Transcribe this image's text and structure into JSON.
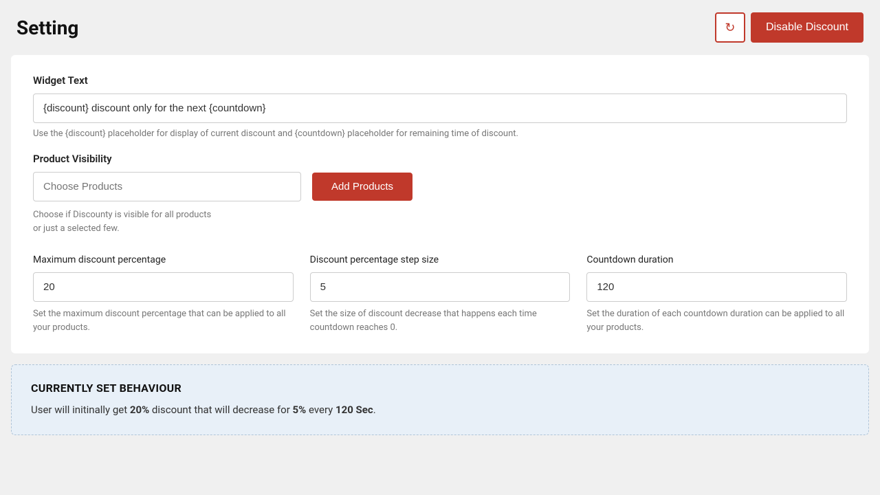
{
  "header": {
    "title": "Setting",
    "refresh_label": "↻",
    "disable_discount_label": "Disable Discount"
  },
  "widget_text_section": {
    "label": "Widget Text",
    "input_value": "{discount} discount only for the next {countdown}",
    "hint": "Use the {discount} placeholder for display of current discount and {countdown} placeholder for remaining time of discount."
  },
  "product_visibility_section": {
    "label": "Product Visibility",
    "choose_products_placeholder": "Choose Products",
    "add_products_label": "Add Products",
    "hint_line1": "Choose if Discounty is visible for all products",
    "hint_line2": "or just a selected few."
  },
  "metrics": {
    "max_discount": {
      "label": "Maximum discount percentage",
      "value": "20",
      "hint": "Set the maximum discount percentage that can be applied to all your products."
    },
    "step_size": {
      "label": "Discount percentage step size",
      "value": "5",
      "hint": "Set the size of discount decrease that happens each time countdown reaches 0."
    },
    "countdown": {
      "label": "Countdown duration",
      "value": "120",
      "hint": "Set the duration of each countdown duration can be applied to all your products."
    }
  },
  "behaviour": {
    "title": "CURRENTLY SET BEHAVIOUR",
    "text_prefix": "User will initinally get ",
    "discount_value": "20%",
    "text_middle": " discount that will decrease for ",
    "step_value": "5%",
    "text_middle2": " every ",
    "countdown_value": "120 Sec",
    "text_suffix": "."
  },
  "colors": {
    "accent": "#c0392b",
    "background": "#f0f0f0",
    "card_bg": "#ffffff",
    "behaviour_bg": "#e8f0f8"
  }
}
